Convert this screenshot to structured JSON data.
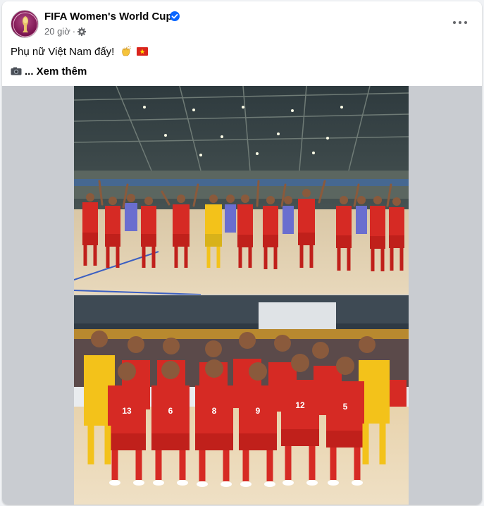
{
  "post": {
    "author": "FIFA Women's World Cup",
    "timestamp": "20 giờ",
    "text": "Phụ nữ Việt Nam đấy!",
    "see_more": "... Xem thêm"
  },
  "icons": {
    "avatar": "trophy-logo",
    "verified": "verified-badge-icon",
    "audience": "gear-icon",
    "more": "more-options-icon",
    "emoji_1": "clapping-hands-emoji",
    "emoji_2": "vietnam-flag-emoji",
    "camera": "camera-emoji"
  },
  "colors": {
    "brand": "#7b1450",
    "verified": "#0866ff",
    "jersey_red": "#d62a24",
    "jersey_yellow": "#f3c21a",
    "court": "#e3c89a"
  },
  "photos": [
    {
      "description_text": ""
    },
    {
      "description_text": ""
    }
  ]
}
